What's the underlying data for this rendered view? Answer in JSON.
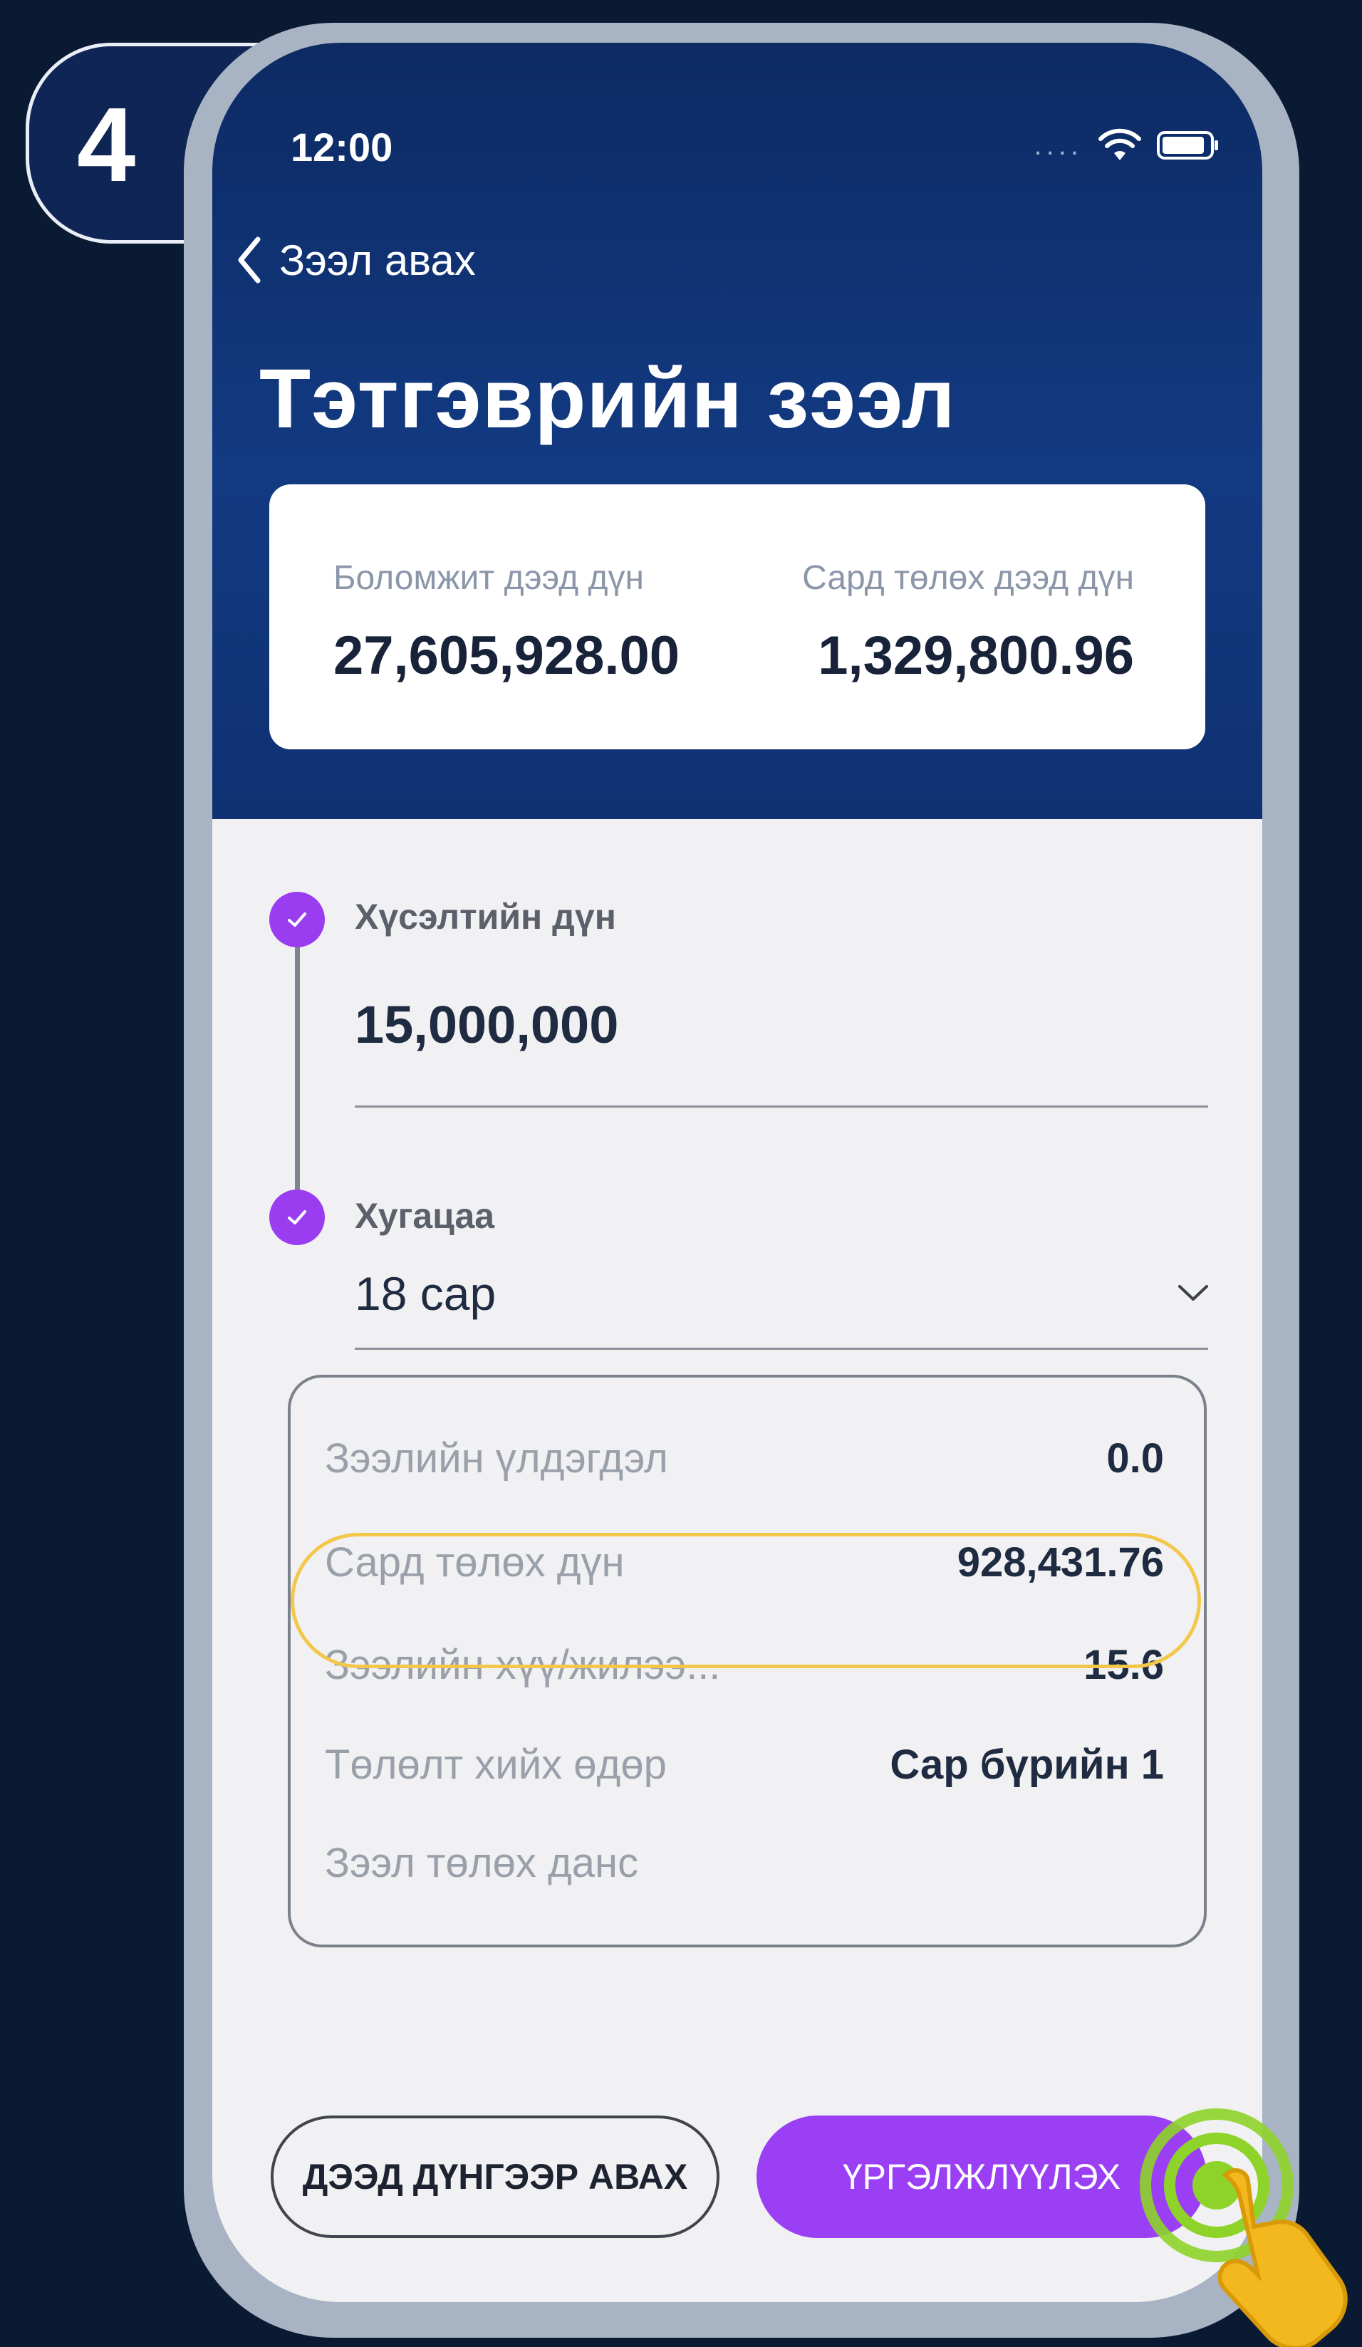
{
  "step": {
    "number": "4"
  },
  "status_bar": {
    "time": "12:00",
    "signal": "....",
    "wifi_icon": "wifi-icon",
    "battery_icon": "battery-icon"
  },
  "nav": {
    "back_label": "Зээл авах",
    "back_icon": "chevron-left-icon"
  },
  "header": {
    "title": "Тэтгэврийн зээл"
  },
  "summary": {
    "max_available_label": "Боломжит дээд дүн",
    "max_available_value": "27,605,928.00",
    "max_monthly_label": "Сард төлөх дээд дүн",
    "max_monthly_value": "1,329,800.96"
  },
  "form": {
    "amount_label": "Хүсэлтийн дүн",
    "amount_value": "15,000,000",
    "term_label": "Хугацаа",
    "term_value": "18 сар"
  },
  "details": {
    "rows": [
      {
        "label": "Зээлийн үлдэгдэл",
        "value": "0.0"
      },
      {
        "label": "Сард төлөх дүн",
        "value": "928,431.76"
      },
      {
        "label": "Зээлийн хүү/жилээ...",
        "value": "15.6"
      },
      {
        "label": "Төлөлт хийх өдөр",
        "value": "Сар бүрийн 1"
      },
      {
        "label": "Зээл төлөх данс",
        "value": ""
      }
    ]
  },
  "actions": {
    "max_button_label": "ДЭЭД ДҮНГЭЭР АВАХ",
    "continue_button_label": "ҮРГЭЛЖЛҮҮЛЭХ"
  },
  "colors": {
    "header_blue": "#123a82",
    "accent_purple": "#9a3ff4",
    "highlight_yellow": "#f2c74a",
    "tap_green": "#8ed329"
  }
}
